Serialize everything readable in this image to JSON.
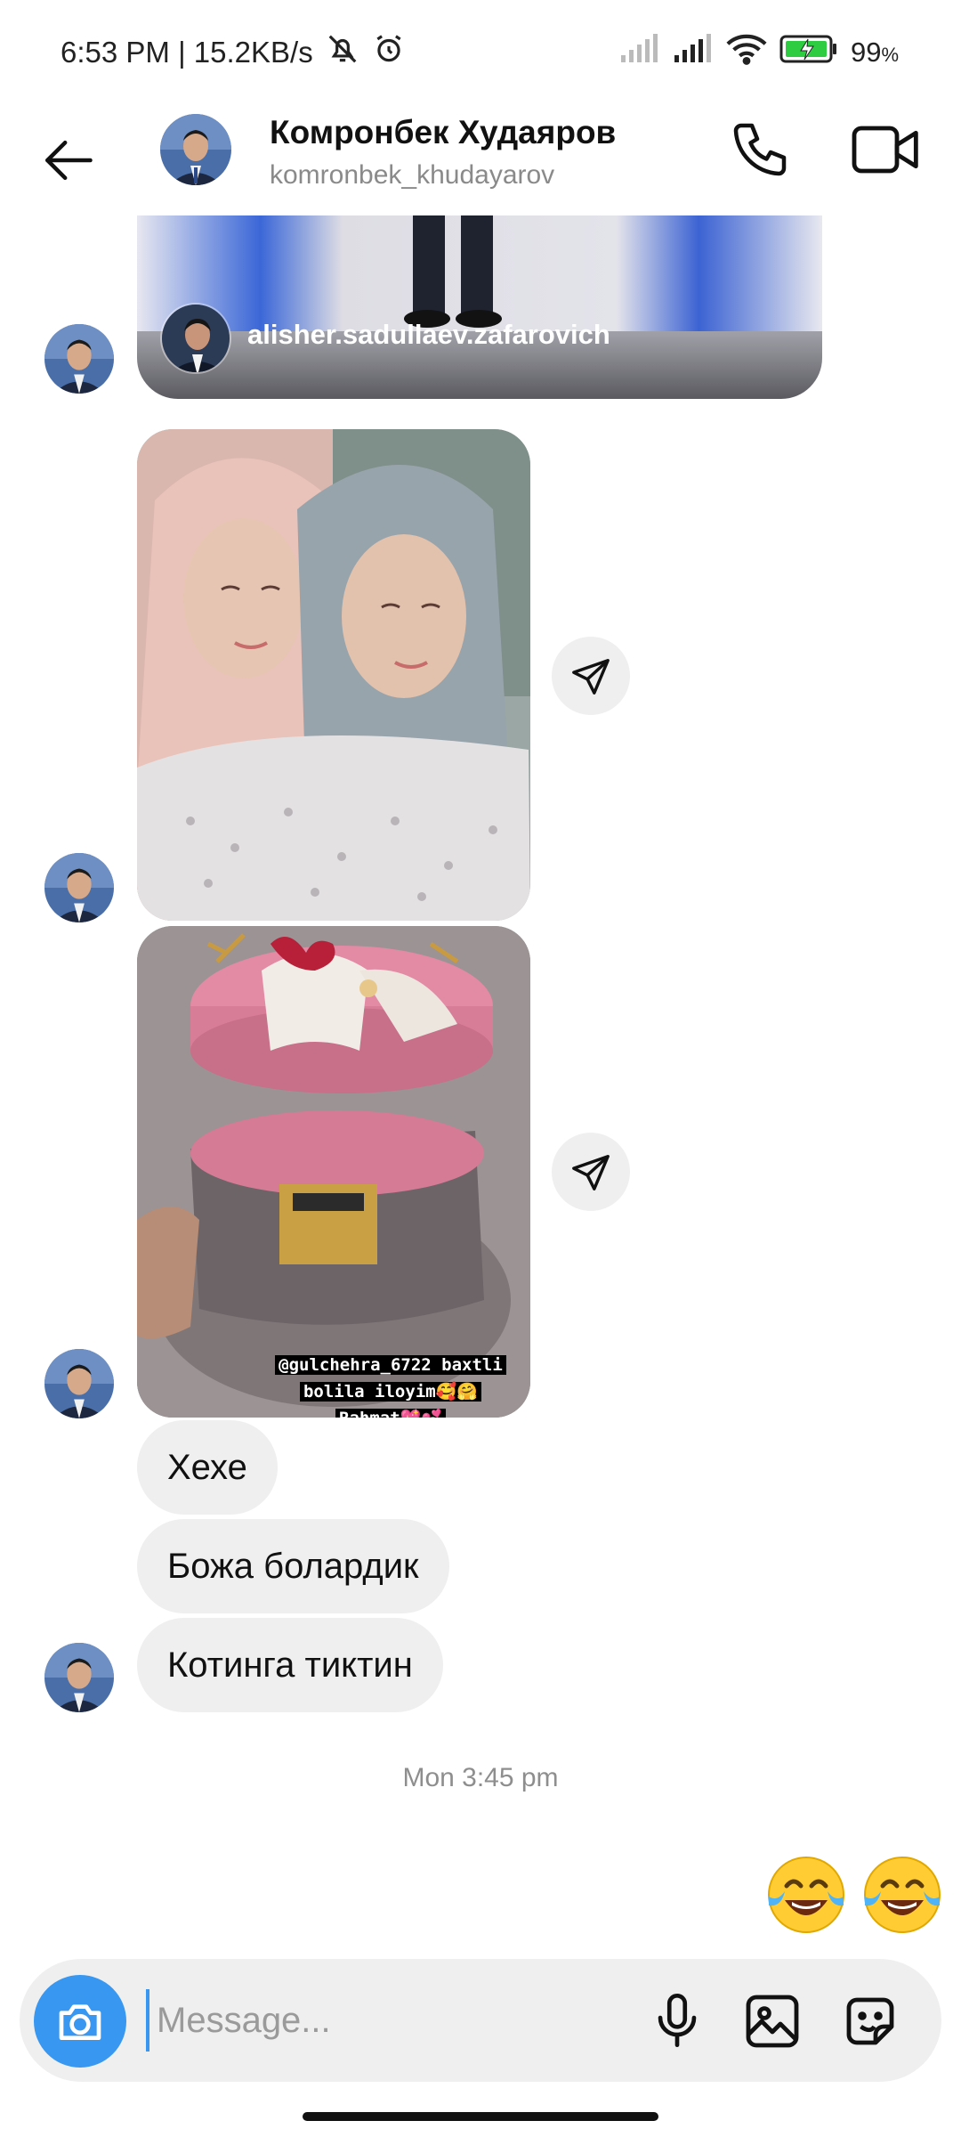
{
  "status_bar": {
    "time_speed": "6:53 PM | 15.2KB/s",
    "battery": "99",
    "battery_unit": "%",
    "icons": [
      "mute-icon",
      "alarm-icon",
      "signal-icon",
      "signal-icon",
      "wifi-icon",
      "battery-charging-icon"
    ]
  },
  "header": {
    "name": "Комронбек Худаяров",
    "username": "komronbek_khudayarov",
    "icons": [
      "back-arrow-icon",
      "phone-icon",
      "video-camera-icon"
    ]
  },
  "messages": {
    "shared_post": {
      "author": "alisher.sadullaev.zafarovich"
    },
    "photo_2_caption": [
      "@gulchehra_6722 baxtli",
      "bolila iloyim🥰🤗",
      "Rahmat💖💕"
    ],
    "text_1": "Хехе",
    "text_2": "Божа болардик",
    "text_3": "Котинга тиктин",
    "timestamp": "Mon 3:45 pm",
    "sent_emoji": "😂😂"
  },
  "composer": {
    "placeholder": "Message...",
    "icons": [
      "camera-icon",
      "microphone-icon",
      "gallery-icon",
      "sticker-icon"
    ]
  },
  "colors": {
    "accent": "#3897f0",
    "bubble": "#efefef",
    "secondary_text": "#8e8e8e"
  }
}
